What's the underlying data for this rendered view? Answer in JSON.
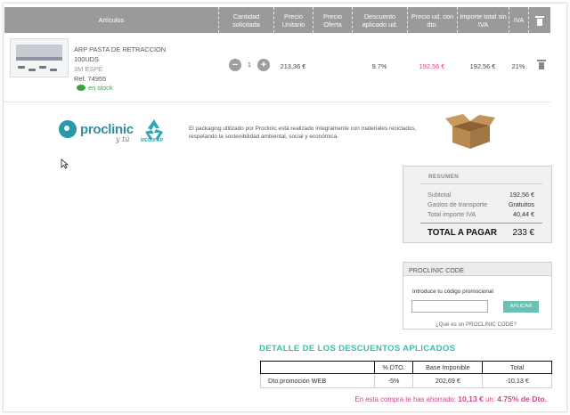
{
  "header": {
    "articulos": "Artículos",
    "cantidad": "Cantidad solicitada",
    "precio_unitario": "Precio Unitario",
    "precio_oferta": "Precio Oferta",
    "descuento": "Descuento aplicado ud.",
    "precio_dto": "Precio ud. con dto.",
    "importe": "Importe total sin IVA",
    "iva": "IVA"
  },
  "product": {
    "name": "ARP PASTA DE RETRACCION",
    "size": "100UDS",
    "brand": "3M ESPE",
    "ref": "Ref. 74955",
    "stock": "en stock",
    "quantity": "1",
    "precio_unitario": "213,36 €",
    "precio_oferta": "",
    "descuento": "9.7%",
    "precio_dto": "192,56 €",
    "importe": "192,56 €",
    "iva": "21%"
  },
  "eco": {
    "brand": "proclinic",
    "brand_sub": "y tú",
    "recycle_label": "RECIPAP",
    "text": "El packaging utilizado por Proclinic está realizado íntegramente con materiales reciclados, respetando la sostenibilidad ambiental, social y económica."
  },
  "resumen": {
    "title": "RESUMEN",
    "subtotal_label": "Subtotal",
    "subtotal": "192,56 €",
    "transporte_label": "Gastos de transporte",
    "transporte": "Gratuitos",
    "iva_label": "Total importe IVA",
    "iva": "40,44 €",
    "total_label": "TOTAL A PAGAR",
    "total": "233 €"
  },
  "code": {
    "title": "PROCLINIC CODE",
    "label": "Introduce tu código promocional",
    "input_value": "",
    "button": "APLICAR",
    "link": "¿Qué es un PROCLINIC CODE?"
  },
  "discounts": {
    "title": "DETALLE DE LOS DESCUENTOS APLICADOS",
    "columns": [
      "",
      "% DTO.",
      "Base Imponible",
      "Total"
    ],
    "rows": [
      [
        "Dto.promoción WEB",
        "-5%",
        "202,69 €",
        "-10,13 €"
      ]
    ],
    "saved_prefix": "En esta compra te has ahorrado:",
    "saved_amount": "10,13 €",
    "saved_mid": "un:",
    "saved_pct": "4.75% de Dto."
  },
  "colors": {
    "header_bg": "#9a9a9a",
    "accent_pink": "#d2468a",
    "accent_teal": "#3dbda6",
    "stock_green": "#3aa43a"
  }
}
